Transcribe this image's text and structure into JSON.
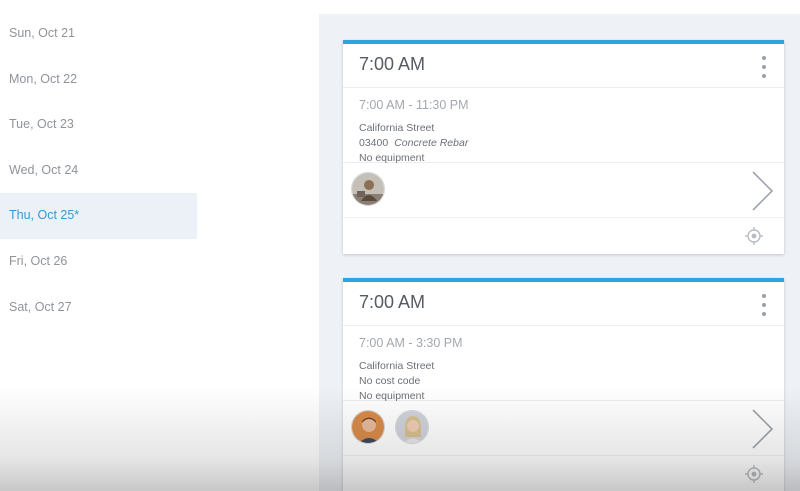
{
  "days": [
    {
      "label": "Sun, Oct 21"
    },
    {
      "label": "Mon, Oct 22"
    },
    {
      "label": "Tue, Oct 23"
    },
    {
      "label": "Wed, Oct 24"
    },
    {
      "label": "Thu, Oct 25*"
    },
    {
      "label": "Fri, Oct 26"
    },
    {
      "label": "Sat, Oct 27"
    }
  ],
  "selected_day": "Thu, Oct 25*",
  "shifts": [
    {
      "title": "7:00 AM",
      "time_range": "7:00 AM - 11:30 PM",
      "location": "California Street",
      "cost_code": "03400",
      "cost_code_name": "Concrete Rebar",
      "equipment": "No equipment"
    },
    {
      "title": "7:00 AM",
      "time_range": "7:00 AM - 3:30 PM",
      "location": "California Street",
      "cost_code": "No cost code",
      "equipment": "No equipment"
    }
  ],
  "colors": {
    "accent": "#2ea3dd",
    "selected_text": "#2e9bd6",
    "selected_bg": "#ebf1f6",
    "panel_bg": "#eef1f5"
  },
  "icons": {
    "menu": "kebab-menu-icon",
    "open": "chevron-right-icon",
    "locate": "crosshair-icon"
  }
}
